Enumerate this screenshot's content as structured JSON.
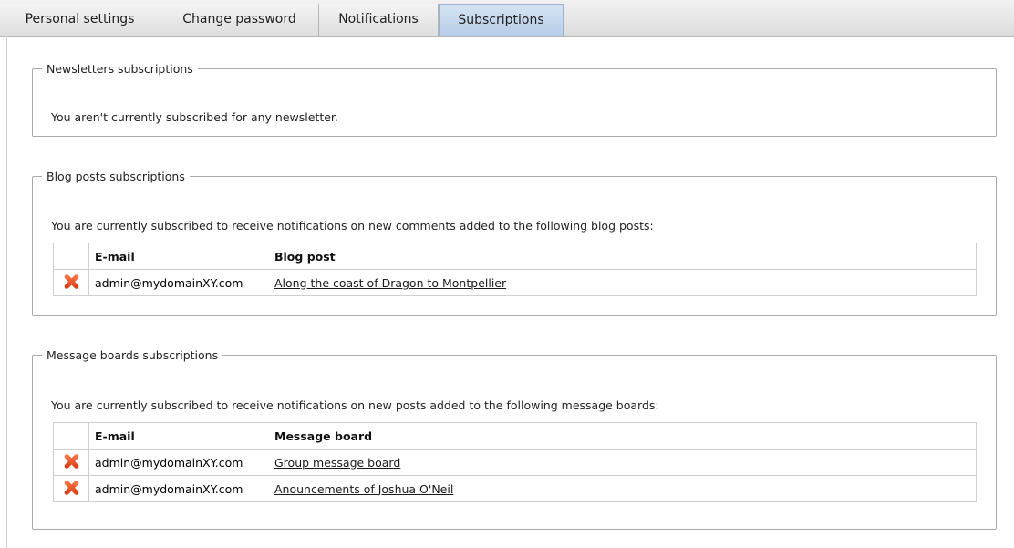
{
  "tabs": [
    {
      "label": "Personal settings"
    },
    {
      "label": "Change password"
    },
    {
      "label": "Notifications"
    },
    {
      "label": "Subscriptions"
    }
  ],
  "newsletters": {
    "legend": "Newsletters subscriptions",
    "message": "You aren't currently subscribed for any newsletter."
  },
  "blog": {
    "legend": "Blog posts subscriptions",
    "message": "You are currently subscribed to receive notifications on new comments added to the following blog posts:",
    "headers": {
      "email": "E-mail",
      "item": "Blog post"
    },
    "rows": [
      {
        "email": "admin@mydomainXY.com",
        "item": "Along the coast of Dragon to Montpellier",
        "icon": "delete-icon"
      }
    ]
  },
  "boards": {
    "legend": "Message boards subscriptions",
    "message": "You are currently subscribed to receive notifications on new posts added to the following message boards:",
    "headers": {
      "email": "E-mail",
      "item": "Message board"
    },
    "rows": [
      {
        "email": "admin@mydomainXY.com",
        "item": "Group message board",
        "icon": "delete-icon"
      },
      {
        "email": "admin@mydomainXY.com",
        "item": "Anouncements of Joshua O'Neil",
        "icon": "delete-icon"
      }
    ]
  }
}
